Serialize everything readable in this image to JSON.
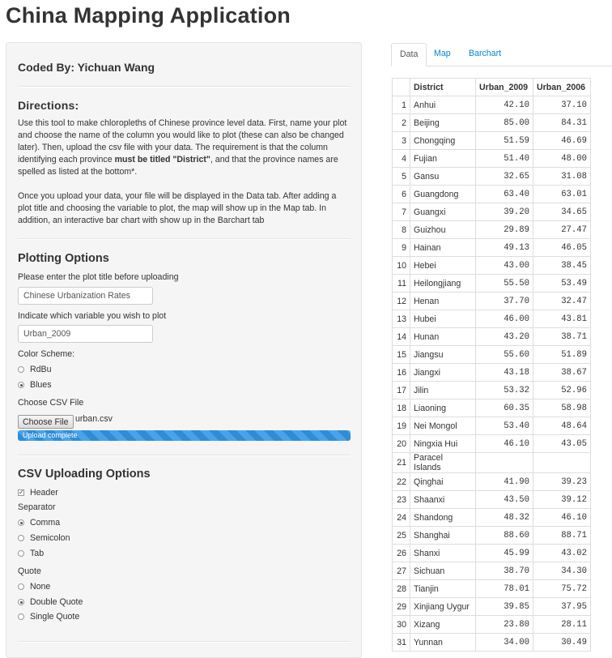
{
  "app": {
    "title": "China Mapping Application"
  },
  "sidebar": {
    "coded_by": "Coded By: Yichuan Wang",
    "directions": {
      "heading": "Directions:",
      "para1_a": "Use this tool to make chloropleths of Chinese province level data. First, name your plot and choose the name of the column you would like to plot (these can also be changed later). Then, upload the csv file with your data. The requirement is that the column identifying each province ",
      "para1_bold": "must be titled \"District\"",
      "para1_b": ", and that the province names are spelled as listed at the bottom*.",
      "para2": "Once you upload your data, your file will be displayed in the Data tab. After adding a plot title and choosing the variable to plot, the map will show up in the Map tab. In addition, an interactive bar chart with show up in the Barchart tab"
    },
    "plotting": {
      "heading": "Plotting Options",
      "title_label": "Please enter the plot title before uploading",
      "title_value": "Chinese Urbanization Rates",
      "var_label": "Indicate which variable you wish to plot",
      "var_value": "Urban_2009",
      "color_label": "Color Scheme:",
      "color_options": [
        "RdBu",
        "Blues"
      ],
      "color_selected": "Blues",
      "csv_label": "Choose CSV File",
      "choose_btn": "Choose File",
      "file_name": "urban.csv",
      "upload_status": "Upload complete",
      "upload_progress": 1.0
    },
    "csv_options": {
      "heading": "CSV Uploading Options",
      "header_label": "Header",
      "header_checked": true,
      "separator_label": "Separator",
      "separator_options": [
        "Comma",
        "Semicolon",
        "Tab"
      ],
      "separator_selected": "Comma",
      "quote_label": "Quote",
      "quote_options": [
        "None",
        "Double Quote",
        "Single Quote"
      ],
      "quote_selected": "Double Quote"
    }
  },
  "tabs": [
    "Data",
    "Map",
    "Barchart"
  ],
  "active_tab": "Data",
  "table": {
    "columns": [
      "",
      "District",
      "Urban_2009",
      "Urban_2006"
    ],
    "rows": [
      [
        "1",
        "Anhui",
        "42.10",
        "37.10"
      ],
      [
        "2",
        "Beijing",
        "85.00",
        "84.31"
      ],
      [
        "3",
        "Chongqing",
        "51.59",
        "46.69"
      ],
      [
        "4",
        "Fujian",
        "51.40",
        "48.00"
      ],
      [
        "5",
        "Gansu",
        "32.65",
        "31.08"
      ],
      [
        "6",
        "Guangdong",
        "63.40",
        "63.01"
      ],
      [
        "7",
        "Guangxi",
        "39.20",
        "34.65"
      ],
      [
        "8",
        "Guizhou",
        "29.89",
        "27.47"
      ],
      [
        "9",
        "Hainan",
        "49.13",
        "46.05"
      ],
      [
        "10",
        "Hebei",
        "43.00",
        "38.45"
      ],
      [
        "11",
        "Heilongjiang",
        "55.50",
        "53.49"
      ],
      [
        "12",
        "Henan",
        "37.70",
        "32.47"
      ],
      [
        "13",
        "Hubei",
        "46.00",
        "43.81"
      ],
      [
        "14",
        "Hunan",
        "43.20",
        "38.71"
      ],
      [
        "15",
        "Jiangsu",
        "55.60",
        "51.89"
      ],
      [
        "16",
        "Jiangxi",
        "43.18",
        "38.67"
      ],
      [
        "17",
        "Jilin",
        "53.32",
        "52.96"
      ],
      [
        "18",
        "Liaoning",
        "60.35",
        "58.98"
      ],
      [
        "19",
        "Nei Mongol",
        "53.40",
        "48.64"
      ],
      [
        "20",
        "Ningxia Hui",
        "46.10",
        "43.05"
      ],
      [
        "21",
        "Paracel Islands",
        "",
        ""
      ],
      [
        "22",
        "Qinghai",
        "41.90",
        "39.23"
      ],
      [
        "23",
        "Shaanxi",
        "43.50",
        "39.12"
      ],
      [
        "24",
        "Shandong",
        "48.32",
        "46.10"
      ],
      [
        "25",
        "Shanghai",
        "88.60",
        "88.71"
      ],
      [
        "26",
        "Shanxi",
        "45.99",
        "43.02"
      ],
      [
        "27",
        "Sichuan",
        "38.70",
        "34.30"
      ],
      [
        "28",
        "Tianjin",
        "78.01",
        "75.72"
      ],
      [
        "29",
        "Xinjiang Uygur",
        "39.85",
        "37.95"
      ],
      [
        "30",
        "Xizang",
        "23.80",
        "28.11"
      ],
      [
        "31",
        "Yunnan",
        "34.00",
        "30.49"
      ]
    ]
  }
}
